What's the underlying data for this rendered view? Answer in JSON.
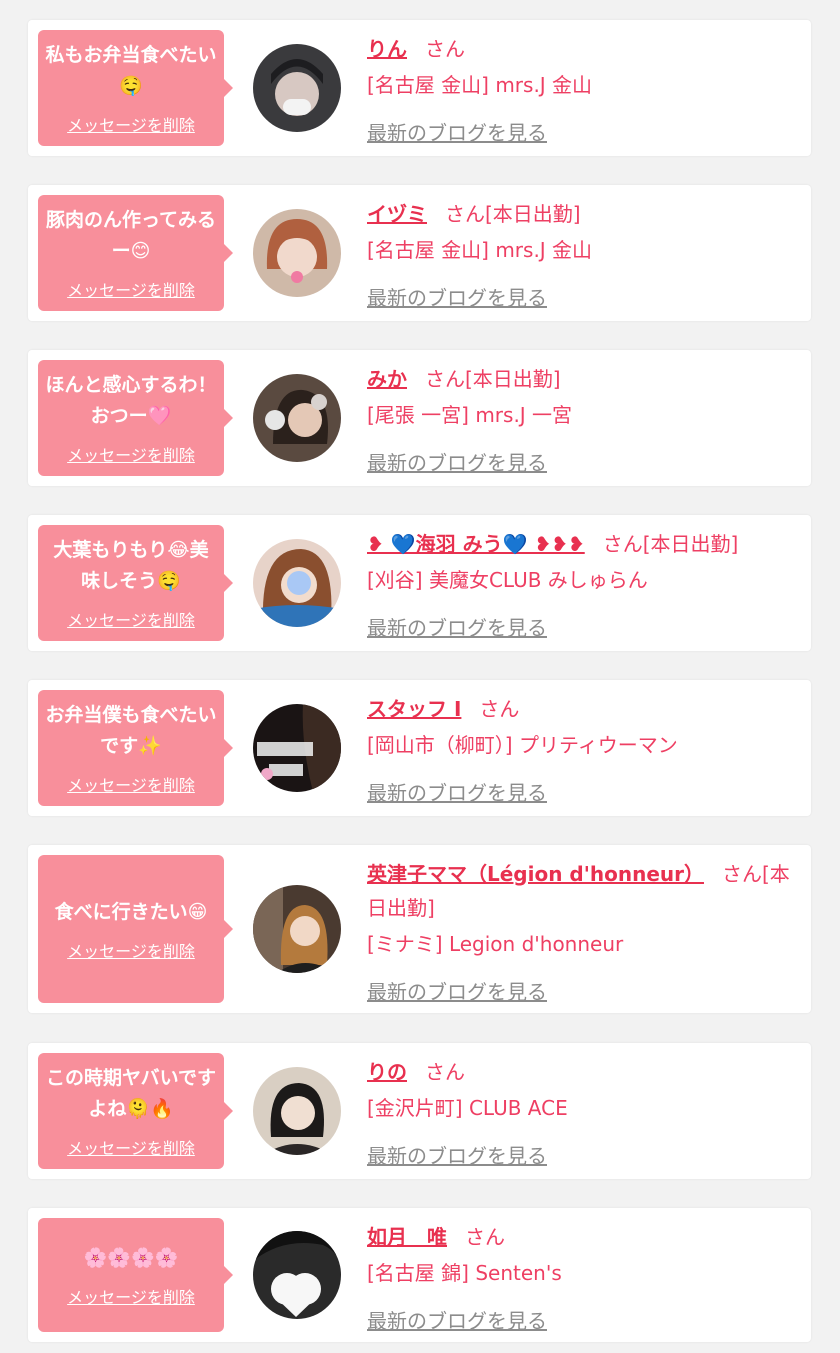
{
  "delete_label": "メッセージを削除",
  "blog_label": "最新のブログを見る",
  "items": [
    {
      "message": "私もお弁当食べたい🤤",
      "name": "りん",
      "suffix": "さん",
      "shop": "[名古屋 金山] mrs.J 金山"
    },
    {
      "message": "豚肉のん作ってみるー😊",
      "name": "イヅミ",
      "suffix": "さん[本日出勤]",
      "shop": "[名古屋 金山] mrs.J 金山"
    },
    {
      "message": "ほんと感心するわ！おつー🩷",
      "name": "みか",
      "suffix": "さん[本日出勤]",
      "shop": "[尾張 一宮] mrs.J 一宮"
    },
    {
      "message": "大葉もりもり😂美味しそう🤤",
      "name": "❥ 💙海羽 みう💙 ❥❥❥",
      "suffix": "さん[本日出勤]",
      "shop": "[刈谷] 美魔女CLUB みしゅらん"
    },
    {
      "message": "お弁当僕も食べたいです✨",
      "name": "スタッフ I",
      "suffix": "さん",
      "shop": "[岡山市（柳町）] プリティウーマン"
    },
    {
      "message": "食べに行きたい😁",
      "name": "英津子ママ（Légion d'honneur）",
      "suffix": "さん[本日出勤]",
      "shop": "[ミナミ] Legion d'honneur"
    },
    {
      "message": "この時期ヤバいですよね🫠🔥",
      "name": "りの",
      "suffix": "さん",
      "shop": "[金沢片町] CLUB ACE"
    },
    {
      "message": "🌸🌸🌸🌸",
      "name": "如月　唯",
      "suffix": "さん",
      "shop": "[名古屋 錦] Senten's"
    }
  ]
}
